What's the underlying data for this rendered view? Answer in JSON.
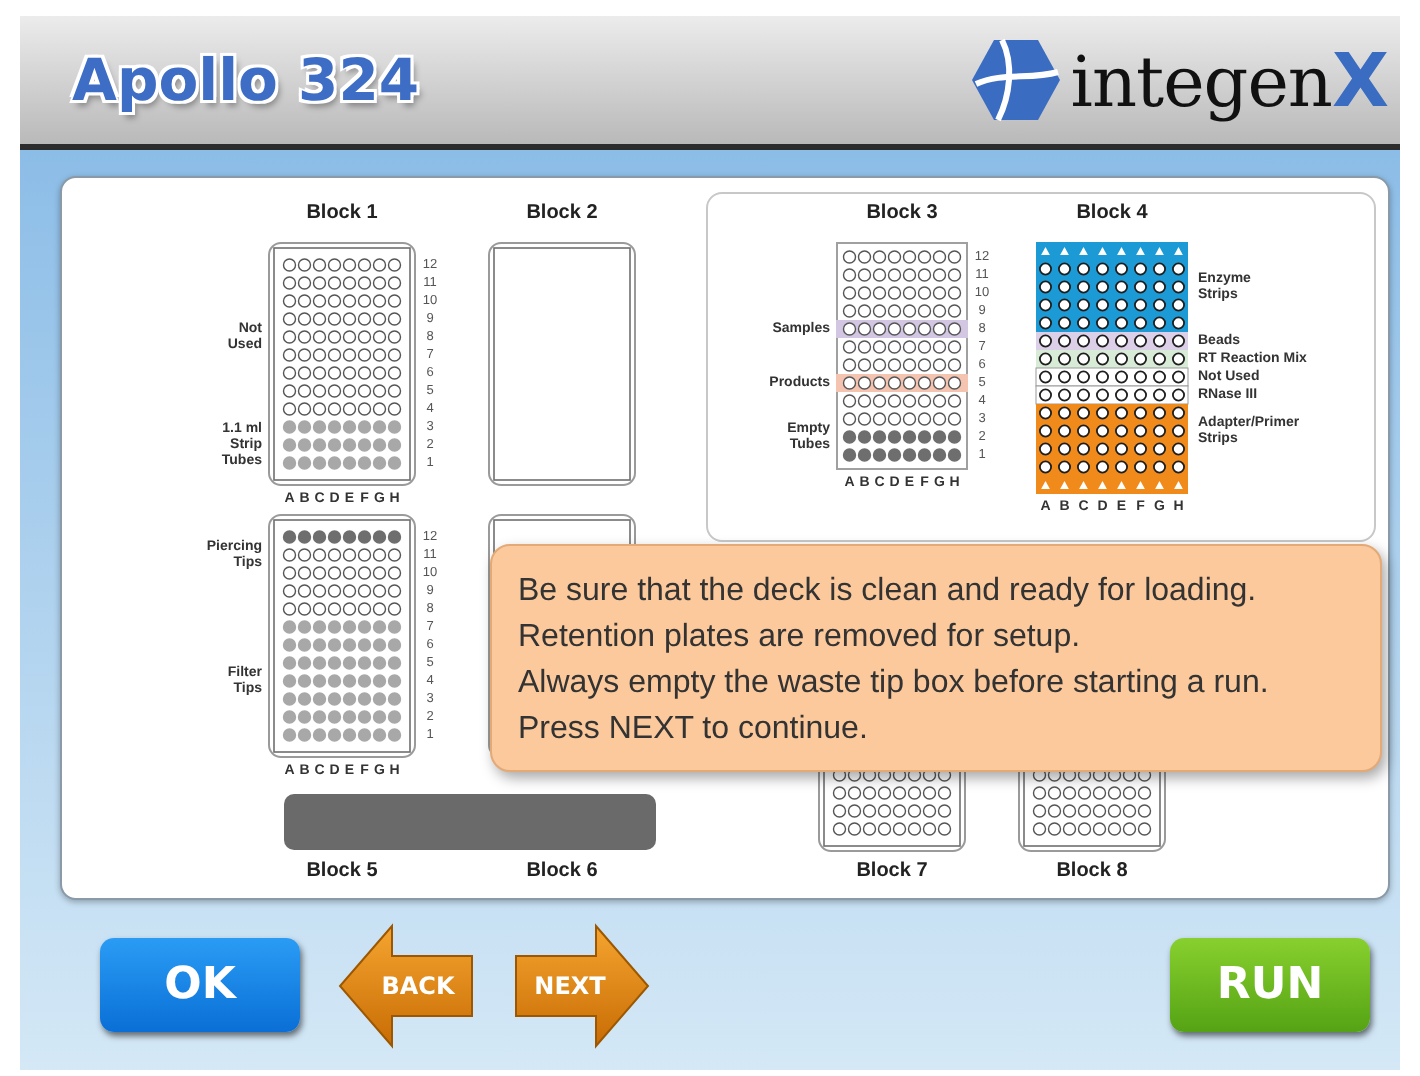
{
  "header": {
    "title": "Apollo 324",
    "logo": {
      "name": "integen",
      "mark": "X"
    }
  },
  "blocks": [
    {
      "label": "Block 1",
      "kind": "tray",
      "columns": [
        "A",
        "B",
        "C",
        "D",
        "E",
        "F",
        "G",
        "H"
      ],
      "rows": [
        {
          "kind": "open",
          "label": "12"
        },
        {
          "kind": "open",
          "label": "11"
        },
        {
          "kind": "open",
          "label": "10"
        },
        {
          "kind": "open",
          "label": "9"
        },
        {
          "kind": "open",
          "label": "8",
          "note": "Not\nUsed"
        },
        {
          "kind": "open",
          "label": "7"
        },
        {
          "kind": "open",
          "label": "6"
        },
        {
          "kind": "open",
          "label": "5"
        },
        {
          "kind": "open",
          "label": "4"
        },
        {
          "kind": "filled",
          "label": "3"
        },
        {
          "kind": "filled",
          "label": "2",
          "note": "1.1 ml\nStrip\nTubes"
        },
        {
          "kind": "filled",
          "label": "1"
        }
      ]
    },
    {
      "label": "Block 2",
      "kind": "tray"
    },
    {
      "label": "Block 3",
      "kind": "rack",
      "columns": [
        "A",
        "B",
        "C",
        "D",
        "E",
        "F",
        "G",
        "H"
      ],
      "rows": [
        {
          "kind": "open",
          "label": "12"
        },
        {
          "kind": "open",
          "label": "11"
        },
        {
          "kind": "open",
          "label": "10"
        },
        {
          "kind": "open",
          "label": "9"
        },
        {
          "kind": "open",
          "label": "8",
          "color": "#d2c6e3",
          "note": "Samples"
        },
        {
          "kind": "open",
          "label": "7"
        },
        {
          "kind": "open",
          "label": "6"
        },
        {
          "kind": "open",
          "label": "5",
          "color": "#f5c4b1",
          "note": "Products"
        },
        {
          "kind": "open",
          "label": "4"
        },
        {
          "kind": "open",
          "label": "3"
        },
        {
          "kind": "dark",
          "label": "2",
          "note": "Empty\nTubes"
        },
        {
          "kind": "dark",
          "label": "1"
        }
      ]
    },
    {
      "label": "Block 4",
      "kind": "colored",
      "columns": [
        "A",
        "B",
        "C",
        "D",
        "E",
        "F",
        "G",
        "H"
      ],
      "rows": [
        {
          "kind": "strip",
          "color": "#1c9ad6"
        },
        {
          "kind": "open",
          "color": "#1c9ad6"
        },
        {
          "kind": "open",
          "color": "#1c9ad6",
          "note": "Enzyme\nStrips"
        },
        {
          "kind": "open",
          "color": "#1c9ad6"
        },
        {
          "kind": "open",
          "color": "#1c9ad6"
        },
        {
          "kind": "open",
          "color": "#dccfe8",
          "note": "Beads"
        },
        {
          "kind": "open",
          "color": "#d8ebd6",
          "note": "RT Reaction Mix"
        },
        {
          "kind": "open",
          "note": "Not Used"
        },
        {
          "kind": "open",
          "note": "RNase III"
        },
        {
          "kind": "open",
          "color": "#f08a1a"
        },
        {
          "kind": "open",
          "color": "#f08a1a",
          "note": "Adapter/Primer\nStrips"
        },
        {
          "kind": "open",
          "color": "#f08a1a"
        },
        {
          "kind": "open",
          "color": "#f08a1a"
        },
        {
          "kind": "strip",
          "color": "#f08a1a"
        }
      ]
    },
    {
      "label": "Block 5",
      "kind": "tray",
      "columns": [
        "A",
        "B",
        "C",
        "D",
        "E",
        "F",
        "G",
        "H"
      ],
      "rows": [
        {
          "kind": "dark",
          "label": "12"
        },
        {
          "kind": "open",
          "label": "11",
          "note": "Piercing\nTips"
        },
        {
          "kind": "open",
          "label": "10"
        },
        {
          "kind": "open",
          "label": "9"
        },
        {
          "kind": "open",
          "label": "8"
        },
        {
          "kind": "filled",
          "label": "7"
        },
        {
          "kind": "filled",
          "label": "6"
        },
        {
          "kind": "filled",
          "label": "5"
        },
        {
          "kind": "filled",
          "label": "4",
          "note": "Filter\nTips"
        },
        {
          "kind": "filled",
          "label": "3"
        },
        {
          "kind": "filled",
          "label": "2"
        },
        {
          "kind": "filled",
          "label": "1"
        }
      ]
    },
    {
      "label": "Block 6",
      "kind": "tray"
    },
    {
      "label": "Block 7",
      "kind": "tray",
      "rows": [
        {
          "kind": "open"
        },
        {
          "kind": "open"
        },
        {
          "kind": "open"
        },
        {
          "kind": "open"
        }
      ]
    },
    {
      "label": "Block 8",
      "kind": "tray",
      "rows": [
        {
          "kind": "open"
        },
        {
          "kind": "open"
        },
        {
          "kind": "open"
        },
        {
          "kind": "open"
        }
      ]
    }
  ],
  "message": [
    "Be sure that the deck is clean and ready for loading.",
    "Retention plates are removed for setup.",
    "Always empty the waste tip box before starting a run.",
    "Press NEXT to continue."
  ],
  "buttons": [
    {
      "kind": "ok",
      "label": "OK"
    },
    {
      "kind": "back",
      "label": "BACK"
    },
    {
      "kind": "next",
      "label": "NEXT"
    },
    {
      "kind": "run",
      "label": "RUN"
    }
  ]
}
